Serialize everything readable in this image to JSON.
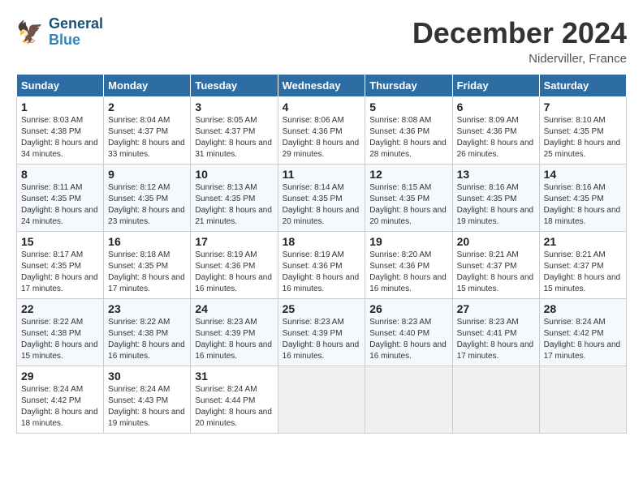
{
  "header": {
    "logo_general": "General",
    "logo_blue": "Blue",
    "month_title": "December 2024",
    "location": "Niderviller, France"
  },
  "calendar": {
    "days_of_week": [
      "Sunday",
      "Monday",
      "Tuesday",
      "Wednesday",
      "Thursday",
      "Friday",
      "Saturday"
    ],
    "weeks": [
      [
        null,
        {
          "day": 2,
          "sunrise": "Sunrise: 8:04 AM",
          "sunset": "Sunset: 4:37 PM",
          "daylight": "Daylight: 8 hours and 33 minutes."
        },
        {
          "day": 3,
          "sunrise": "Sunrise: 8:05 AM",
          "sunset": "Sunset: 4:37 PM",
          "daylight": "Daylight: 8 hours and 31 minutes."
        },
        {
          "day": 4,
          "sunrise": "Sunrise: 8:06 AM",
          "sunset": "Sunset: 4:36 PM",
          "daylight": "Daylight: 8 hours and 29 minutes."
        },
        {
          "day": 5,
          "sunrise": "Sunrise: 8:08 AM",
          "sunset": "Sunset: 4:36 PM",
          "daylight": "Daylight: 8 hours and 28 minutes."
        },
        {
          "day": 6,
          "sunrise": "Sunrise: 8:09 AM",
          "sunset": "Sunset: 4:36 PM",
          "daylight": "Daylight: 8 hours and 26 minutes."
        },
        {
          "day": 7,
          "sunrise": "Sunrise: 8:10 AM",
          "sunset": "Sunset: 4:35 PM",
          "daylight": "Daylight: 8 hours and 25 minutes."
        }
      ],
      [
        {
          "day": 8,
          "sunrise": "Sunrise: 8:11 AM",
          "sunset": "Sunset: 4:35 PM",
          "daylight": "Daylight: 8 hours and 24 minutes."
        },
        {
          "day": 9,
          "sunrise": "Sunrise: 8:12 AM",
          "sunset": "Sunset: 4:35 PM",
          "daylight": "Daylight: 8 hours and 23 minutes."
        },
        {
          "day": 10,
          "sunrise": "Sunrise: 8:13 AM",
          "sunset": "Sunset: 4:35 PM",
          "daylight": "Daylight: 8 hours and 21 minutes."
        },
        {
          "day": 11,
          "sunrise": "Sunrise: 8:14 AM",
          "sunset": "Sunset: 4:35 PM",
          "daylight": "Daylight: 8 hours and 20 minutes."
        },
        {
          "day": 12,
          "sunrise": "Sunrise: 8:15 AM",
          "sunset": "Sunset: 4:35 PM",
          "daylight": "Daylight: 8 hours and 20 minutes."
        },
        {
          "day": 13,
          "sunrise": "Sunrise: 8:16 AM",
          "sunset": "Sunset: 4:35 PM",
          "daylight": "Daylight: 8 hours and 19 minutes."
        },
        {
          "day": 14,
          "sunrise": "Sunrise: 8:16 AM",
          "sunset": "Sunset: 4:35 PM",
          "daylight": "Daylight: 8 hours and 18 minutes."
        }
      ],
      [
        {
          "day": 15,
          "sunrise": "Sunrise: 8:17 AM",
          "sunset": "Sunset: 4:35 PM",
          "daylight": "Daylight: 8 hours and 17 minutes."
        },
        {
          "day": 16,
          "sunrise": "Sunrise: 8:18 AM",
          "sunset": "Sunset: 4:35 PM",
          "daylight": "Daylight: 8 hours and 17 minutes."
        },
        {
          "day": 17,
          "sunrise": "Sunrise: 8:19 AM",
          "sunset": "Sunset: 4:36 PM",
          "daylight": "Daylight: 8 hours and 16 minutes."
        },
        {
          "day": 18,
          "sunrise": "Sunrise: 8:19 AM",
          "sunset": "Sunset: 4:36 PM",
          "daylight": "Daylight: 8 hours and 16 minutes."
        },
        {
          "day": 19,
          "sunrise": "Sunrise: 8:20 AM",
          "sunset": "Sunset: 4:36 PM",
          "daylight": "Daylight: 8 hours and 16 minutes."
        },
        {
          "day": 20,
          "sunrise": "Sunrise: 8:21 AM",
          "sunset": "Sunset: 4:37 PM",
          "daylight": "Daylight: 8 hours and 15 minutes."
        },
        {
          "day": 21,
          "sunrise": "Sunrise: 8:21 AM",
          "sunset": "Sunset: 4:37 PM",
          "daylight": "Daylight: 8 hours and 15 minutes."
        }
      ],
      [
        {
          "day": 22,
          "sunrise": "Sunrise: 8:22 AM",
          "sunset": "Sunset: 4:38 PM",
          "daylight": "Daylight: 8 hours and 15 minutes."
        },
        {
          "day": 23,
          "sunrise": "Sunrise: 8:22 AM",
          "sunset": "Sunset: 4:38 PM",
          "daylight": "Daylight: 8 hours and 16 minutes."
        },
        {
          "day": 24,
          "sunrise": "Sunrise: 8:23 AM",
          "sunset": "Sunset: 4:39 PM",
          "daylight": "Daylight: 8 hours and 16 minutes."
        },
        {
          "day": 25,
          "sunrise": "Sunrise: 8:23 AM",
          "sunset": "Sunset: 4:39 PM",
          "daylight": "Daylight: 8 hours and 16 minutes."
        },
        {
          "day": 26,
          "sunrise": "Sunrise: 8:23 AM",
          "sunset": "Sunset: 4:40 PM",
          "daylight": "Daylight: 8 hours and 16 minutes."
        },
        {
          "day": 27,
          "sunrise": "Sunrise: 8:23 AM",
          "sunset": "Sunset: 4:41 PM",
          "daylight": "Daylight: 8 hours and 17 minutes."
        },
        {
          "day": 28,
          "sunrise": "Sunrise: 8:24 AM",
          "sunset": "Sunset: 4:42 PM",
          "daylight": "Daylight: 8 hours and 17 minutes."
        }
      ],
      [
        {
          "day": 29,
          "sunrise": "Sunrise: 8:24 AM",
          "sunset": "Sunset: 4:42 PM",
          "daylight": "Daylight: 8 hours and 18 minutes."
        },
        {
          "day": 30,
          "sunrise": "Sunrise: 8:24 AM",
          "sunset": "Sunset: 4:43 PM",
          "daylight": "Daylight: 8 hours and 19 minutes."
        },
        {
          "day": 31,
          "sunrise": "Sunrise: 8:24 AM",
          "sunset": "Sunset: 4:44 PM",
          "daylight": "Daylight: 8 hours and 20 minutes."
        },
        null,
        null,
        null,
        null
      ]
    ],
    "week1_day1": {
      "day": 1,
      "sunrise": "Sunrise: 8:03 AM",
      "sunset": "Sunset: 4:38 PM",
      "daylight": "Daylight: 8 hours and 34 minutes."
    }
  }
}
